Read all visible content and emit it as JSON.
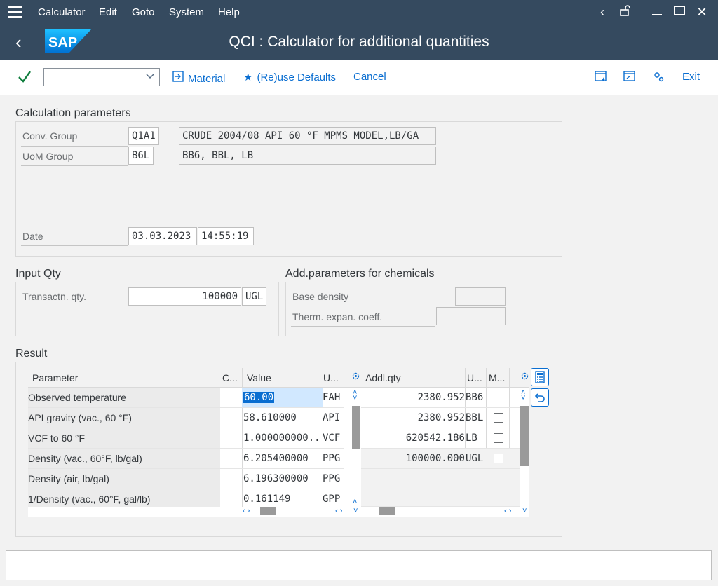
{
  "menubar": {
    "items": [
      "Calculator",
      "Edit",
      "Goto",
      "System",
      "Help"
    ]
  },
  "title": "QCI : Calculator for additional quantities",
  "toolbar": {
    "command_value": "",
    "material_label": "Material",
    "reuse_defaults_label": "(Re)use Defaults",
    "cancel_label": "Cancel",
    "exit_label": "Exit"
  },
  "calc_params": {
    "title": "Calculation parameters",
    "conv_group_label": "Conv. Group",
    "conv_group_code": "Q1A1",
    "conv_group_desc": "CRUDE 2004/08 API 60 °F MPMS MODEL,LB/GA",
    "uom_group_label": "UoM Group",
    "uom_group_code": "B6L",
    "uom_group_desc": "BB6, BBL, LB",
    "date_label": "Date",
    "date_value": "03.03.2023",
    "time_value": "14:55:19"
  },
  "input_qty": {
    "title": "Input Qty",
    "transactn_label": "Transactn. qty.",
    "transactn_value": "100000",
    "transactn_unit": "UGL"
  },
  "add_params": {
    "title": "Add.parameters for chemicals",
    "base_density_label": "Base density",
    "base_density_value": "",
    "therm_label": "Therm. expan. coeff.",
    "therm_value": ""
  },
  "result": {
    "title": "Result",
    "left_headers": {
      "parameter": "Parameter",
      "c": "C...",
      "value": "Value",
      "u": "U..."
    },
    "left_rows": [
      {
        "parameter": "Observed temperature",
        "value": "60.00",
        "unit": "FAH"
      },
      {
        "parameter": "API gravity (vac., 60 °F)",
        "value": "58.610000",
        "unit": "API"
      },
      {
        "parameter": "VCF to 60 °F",
        "value": "1.000000000...",
        "unit": "VCF"
      },
      {
        "parameter": "Density (vac., 60°F, lb/gal)",
        "value": "6.205400000",
        "unit": "PPG"
      },
      {
        "parameter": "Density (air, lb/gal)",
        "value": "6.196300000",
        "unit": "PPG"
      },
      {
        "parameter": "1/Density (vac., 60°F, gal/lb)",
        "value": "0.161149",
        "unit": "GPP"
      }
    ],
    "right_headers": {
      "addl_qty": "Addl.qty",
      "u": "U...",
      "m": "M..."
    },
    "right_rows": [
      {
        "qty": "2380.952",
        "unit": "BB6"
      },
      {
        "qty": "2380.952",
        "unit": "BBL"
      },
      {
        "qty": "620542.186",
        "unit": "LB"
      },
      {
        "qty": "100000.000",
        "unit": "UGL"
      }
    ]
  },
  "status": {
    "message": ""
  }
}
